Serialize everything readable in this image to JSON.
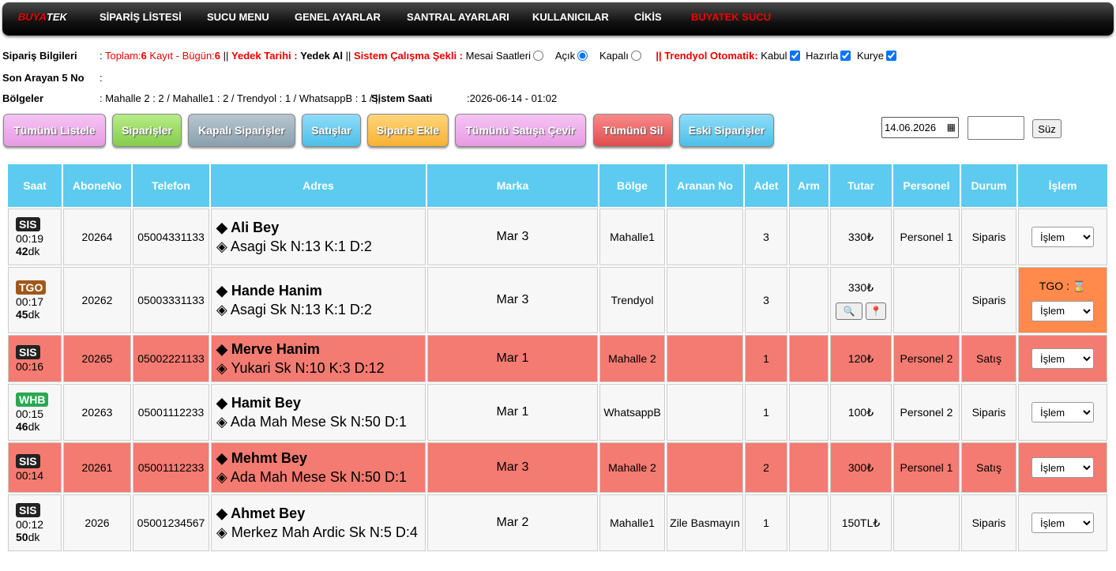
{
  "nav": {
    "brand_prefix": "BUYA",
    "brand_suffix": "TEK",
    "items": [
      "SİPARİŞ LİSTESİ",
      "SUCU MENU",
      "GENEL AYARLAR",
      "SANTRAL AYARLARI",
      "KULLANICILAR",
      "CİKİS"
    ],
    "special": "BUYATEK SUCU"
  },
  "info": {
    "siparis_label": "Sipariş Bilgileri",
    "colon": ":",
    "toplam": "Toplam:",
    "toplam_val": "6",
    "kayit": "Kayıt - Bügün:",
    "bugun_val": "6",
    "sep": "||",
    "yedek_label": "Yedek Tarihi :",
    "yedek_val": "Yedek Al",
    "sistem_label": "Sistem Çalışma Şekli :",
    "mesai": "Mesai Saatleri",
    "acik": "Açık",
    "kapali": "Kapalı",
    "trendyol_label": "|| Trendyol Otomatik:",
    "kabul": "Kabul",
    "hazirla": "Hazırla",
    "kurye": "Kurye",
    "son_label": "Son Arayan 5 No",
    "bolge_label": "Bölgeler",
    "bolge_val": ": Mahalle 2 : 2 / Mahalle1 : 2 / Trendyol : 1 / WhatsappB : 1 / ||",
    "saat_label": "Sistem Saati",
    "saat_val": ":2026-06-14 - 01:02"
  },
  "buttons": [
    "Tümünü Listele",
    "Siparişler",
    "Kapalı Siparişler",
    "Satışlar",
    "Siparis Ekle",
    "Tümünü Satışa Çevir",
    "Tümünü Sil",
    "Eski Siparişler"
  ],
  "filter": {
    "date": "14.06.2026",
    "search_btn": "Süz"
  },
  "table": {
    "headers": [
      "Saat",
      "AboneNo",
      "Telefon",
      "Adres",
      "Marka",
      "Bölge",
      "Aranan No",
      "Adet",
      "Arm",
      "Tutar",
      "Personel",
      "Durum",
      "İşlem"
    ],
    "rows": [
      {
        "tag": "SIS",
        "time": "00:19",
        "mins": "42",
        "unit": "dk",
        "abone": "20264",
        "tel": "05004331133",
        "name": "◆ Ali Bey",
        "addr": "◈ Asagi Sk N:13 K:1 D:2",
        "marka": "Mar 3",
        "bolge": "Mahalle1",
        "aranan": "",
        "adet": "3",
        "tutar": "330₺",
        "personel": "Personel 1",
        "durum": "Siparis",
        "islem": "İşlem"
      },
      {
        "tag": "TGO",
        "time": "00:17",
        "mins": "45",
        "unit": "dk",
        "abone": "20262",
        "tel": "05003331133",
        "name": "◆ Hande Hanim",
        "addr": "◈ Asagi Sk N:13 K:1 D:2",
        "marka": "Mar 3",
        "bolge": "Trendyol",
        "aranan": "",
        "adet": "3",
        "tutar": "330₺",
        "personel": "",
        "durum": "Siparis",
        "islem": "İşlem",
        "tgo": "TGO :"
      },
      {
        "tag": "SIS",
        "time": "00:16",
        "mins": "",
        "unit": "",
        "abone": "20265",
        "tel": "05002221133",
        "name": "◆ Merve Hanim",
        "addr": "◈ Yukari Sk N:10 K:3 D:12",
        "marka": "Mar 1",
        "bolge": "Mahalle 2",
        "aranan": "",
        "adet": "1",
        "tutar": "120₺",
        "personel": "Personel 2",
        "durum": "Satış",
        "islem": "İşlem"
      },
      {
        "tag": "WHB",
        "time": "00:15",
        "mins": "46",
        "unit": "dk",
        "abone": "20263",
        "tel": "05001112233",
        "name": "◆ Hamit Bey",
        "addr": "◈ Ada Mah Mese Sk N:50 D:1",
        "marka": "Mar 1",
        "bolge": "WhatsappB",
        "aranan": "",
        "adet": "1",
        "tutar": "100₺",
        "personel": "Personel 2",
        "durum": "Siparis",
        "islem": "İşlem"
      },
      {
        "tag": "SIS",
        "time": "00:14",
        "mins": "",
        "unit": "",
        "abone": "20261",
        "tel": "05001112233",
        "name": "◆ Mehmt Bey",
        "addr": "◈ Ada Mah Mese Sk N:50 D:1",
        "marka": "Mar 3",
        "bolge": "Mahalle 2",
        "aranan": "",
        "adet": "2",
        "tutar": "300₺",
        "personel": "Personel 1",
        "durum": "Satış",
        "islem": "İşlem"
      },
      {
        "tag": "SIS",
        "time": "00:12",
        "mins": "50",
        "unit": "dk",
        "abone": "2026",
        "tel": "05001234567",
        "name": "◆ Ahmet Bey",
        "addr": "◈ Merkez Mah Ardic Sk N:5 D:4",
        "marka": "Mar 2",
        "bolge": "Mahalle1",
        "aranan": "Zile Basmayın",
        "adet": "1",
        "tutar": "150TL₺",
        "personel": "",
        "durum": "Siparis",
        "islem": "İşlem"
      }
    ]
  }
}
